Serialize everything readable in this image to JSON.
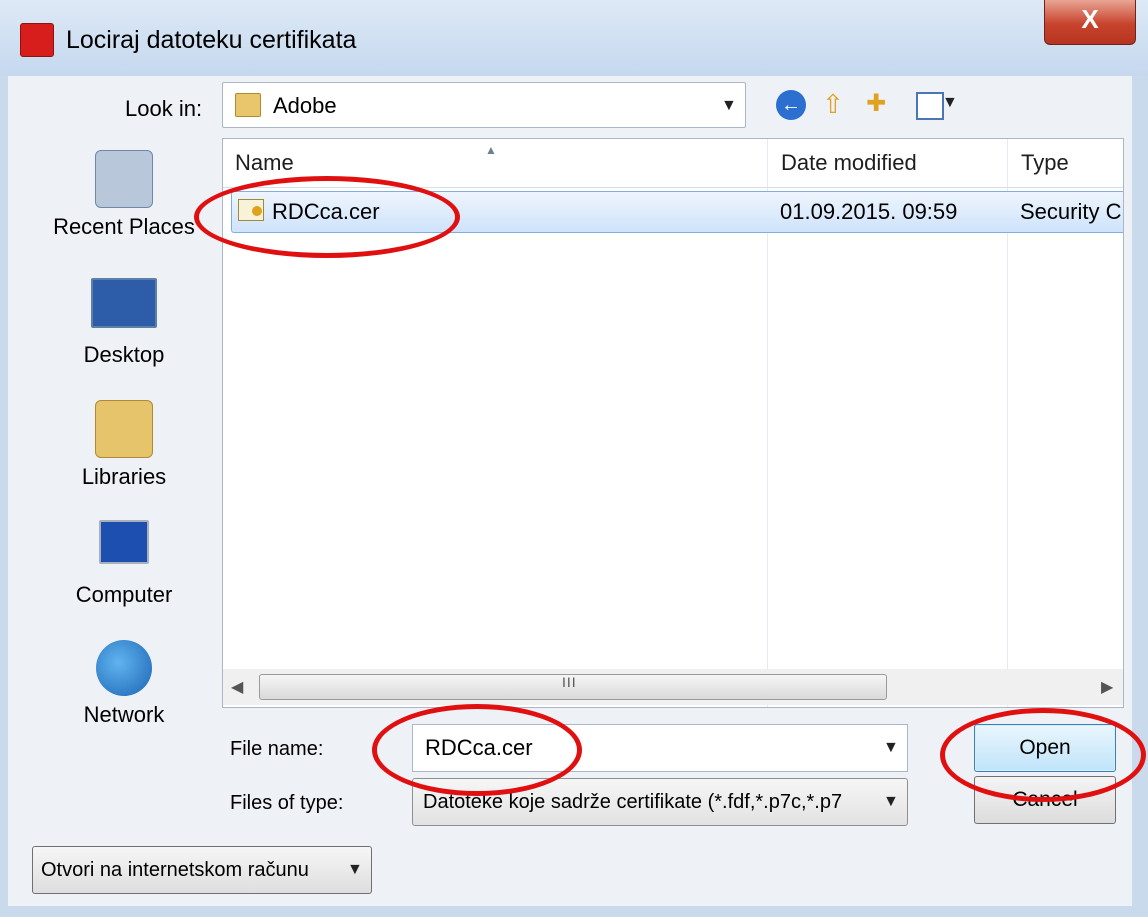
{
  "window": {
    "title": "Lociraj datoteku certifikata",
    "close_glyph": "X"
  },
  "toolbar": {
    "look_in_label": "Look in:",
    "look_in_value": "Adobe",
    "icons": [
      "back-icon",
      "up-folder-icon",
      "new-folder-icon",
      "view-menu-icon"
    ]
  },
  "places": [
    {
      "label": "Recent Places",
      "icon": "recent-places-icon"
    },
    {
      "label": "Desktop",
      "icon": "desktop-icon"
    },
    {
      "label": "Libraries",
      "icon": "libraries-icon"
    },
    {
      "label": "Computer",
      "icon": "computer-icon"
    },
    {
      "label": "Network",
      "icon": "network-icon"
    }
  ],
  "filelist": {
    "columns": [
      "Name",
      "Date modified",
      "Type"
    ],
    "rows": [
      {
        "name": "RDCca.cer",
        "date": "01.09.2015. 09:59",
        "type": "Security C",
        "selected": true
      }
    ],
    "scroll_grip": "III"
  },
  "file_name": {
    "label": "File name:",
    "value": "RDCca.cer"
  },
  "file_type": {
    "label": "Files of type:",
    "value": "Datoteke koje sadrže certifikate (*.fdf,*.p7c,*.p7"
  },
  "buttons": {
    "open": "Open",
    "cancel": "Cancel",
    "online": "Otvori na internetskom računu"
  },
  "colors": {
    "annotation": "#e01010",
    "selection": "#cfe3fb",
    "window_frame": "#c9daed"
  }
}
